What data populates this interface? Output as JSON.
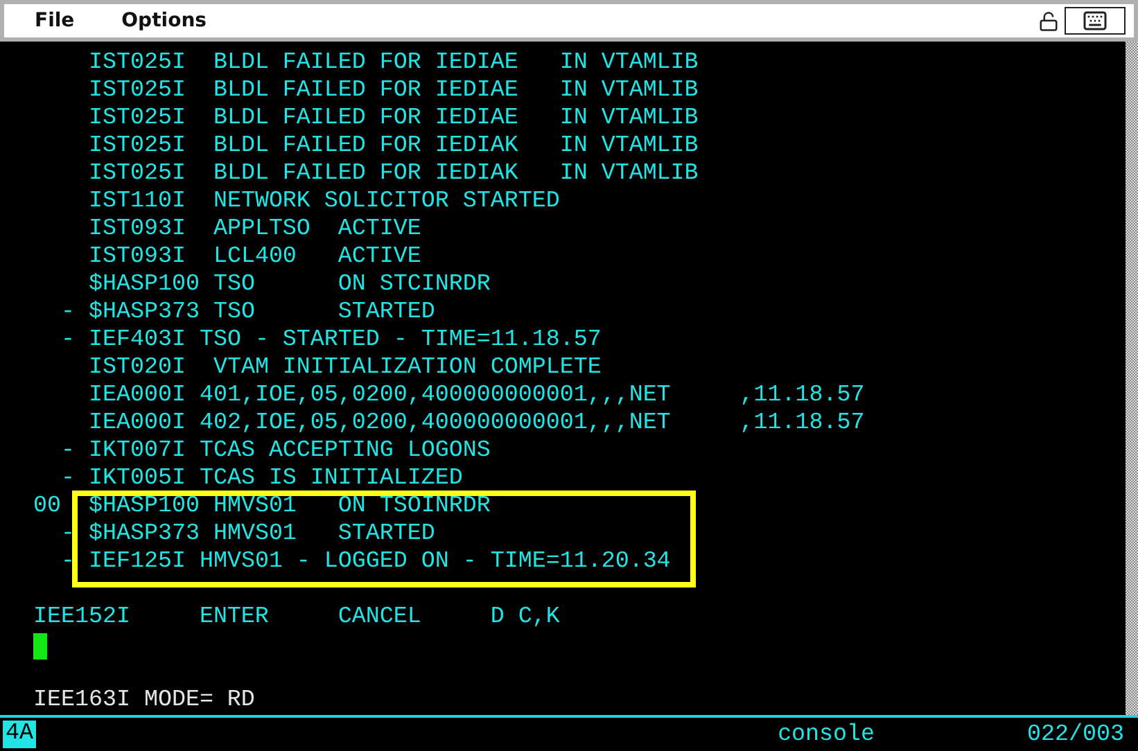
{
  "menu": [
    "File",
    "Options"
  ],
  "console": {
    "rows": [
      {
        "kind": "message",
        "text": "IST025I  BLDL FAILED FOR IEDIAE   IN VTAMLIB"
      },
      {
        "kind": "message",
        "text": "IST025I  BLDL FAILED FOR IEDIAE   IN VTAMLIB"
      },
      {
        "kind": "message",
        "text": "IST025I  BLDL FAILED FOR IEDIAE   IN VTAMLIB"
      },
      {
        "kind": "message",
        "text": "IST025I  BLDL FAILED FOR IEDIAK   IN VTAMLIB"
      },
      {
        "kind": "message",
        "text": "IST025I  BLDL FAILED FOR IEDIAK   IN VTAMLIB"
      },
      {
        "kind": "message",
        "text": "IST110I  NETWORK SOLICITOR STARTED"
      },
      {
        "kind": "message",
        "text": "IST093I  APPLTSO  ACTIVE"
      },
      {
        "kind": "message",
        "text": "IST093I  LCL400   ACTIVE"
      },
      {
        "kind": "message",
        "text": "$HASP100 TSO      ON STCINRDR"
      },
      {
        "kind": "action_message",
        "mark": "-",
        "text": "$HASP373 TSO      STARTED"
      },
      {
        "kind": "action_message",
        "mark": "-",
        "text": "IEF403I TSO - STARTED - TIME=11.18.57"
      },
      {
        "kind": "message",
        "text": "IST020I  VTAM INITIALIZATION COMPLETE"
      },
      {
        "kind": "message",
        "text": "IEA000I 401,IOE,05,0200,400000000001,,,NET     ,11.18.57"
      },
      {
        "kind": "message",
        "text": "IEA000I 402,IOE,05,0200,400000000001,,,NET     ,11.18.57"
      },
      {
        "kind": "action_message",
        "mark": "-",
        "text": "IKT007I TCAS ACCEPTING LOGONS"
      },
      {
        "kind": "action_message",
        "mark": "-",
        "text": "IKT005I TCAS IS INITIALIZED"
      }
    ],
    "highlighted_rows": [
      {
        "kind": "reply_message",
        "mark": "00",
        "text": "$HASP100 HMVS01   ON TSOINRDR"
      },
      {
        "kind": "action_message",
        "mark": "-",
        "text": "$HASP373 HMVS01   STARTED"
      },
      {
        "kind": "action_message",
        "mark": "-",
        "text": "IEF125I HMVS01 - LOGGED ON - TIME=11.20.34"
      }
    ],
    "rows_after": [
      {
        "kind": "blank"
      },
      {
        "kind": "prompt",
        "text": "IEE152I     ENTER     CANCEL     D C,K"
      },
      {
        "kind": "cursor"
      },
      {
        "kind": "blank"
      },
      {
        "kind": "mode",
        "text": "IEE163I MODE= RD"
      }
    ]
  },
  "status_bar": {
    "indicator": "4A",
    "session": "console",
    "position": "022/003"
  }
}
